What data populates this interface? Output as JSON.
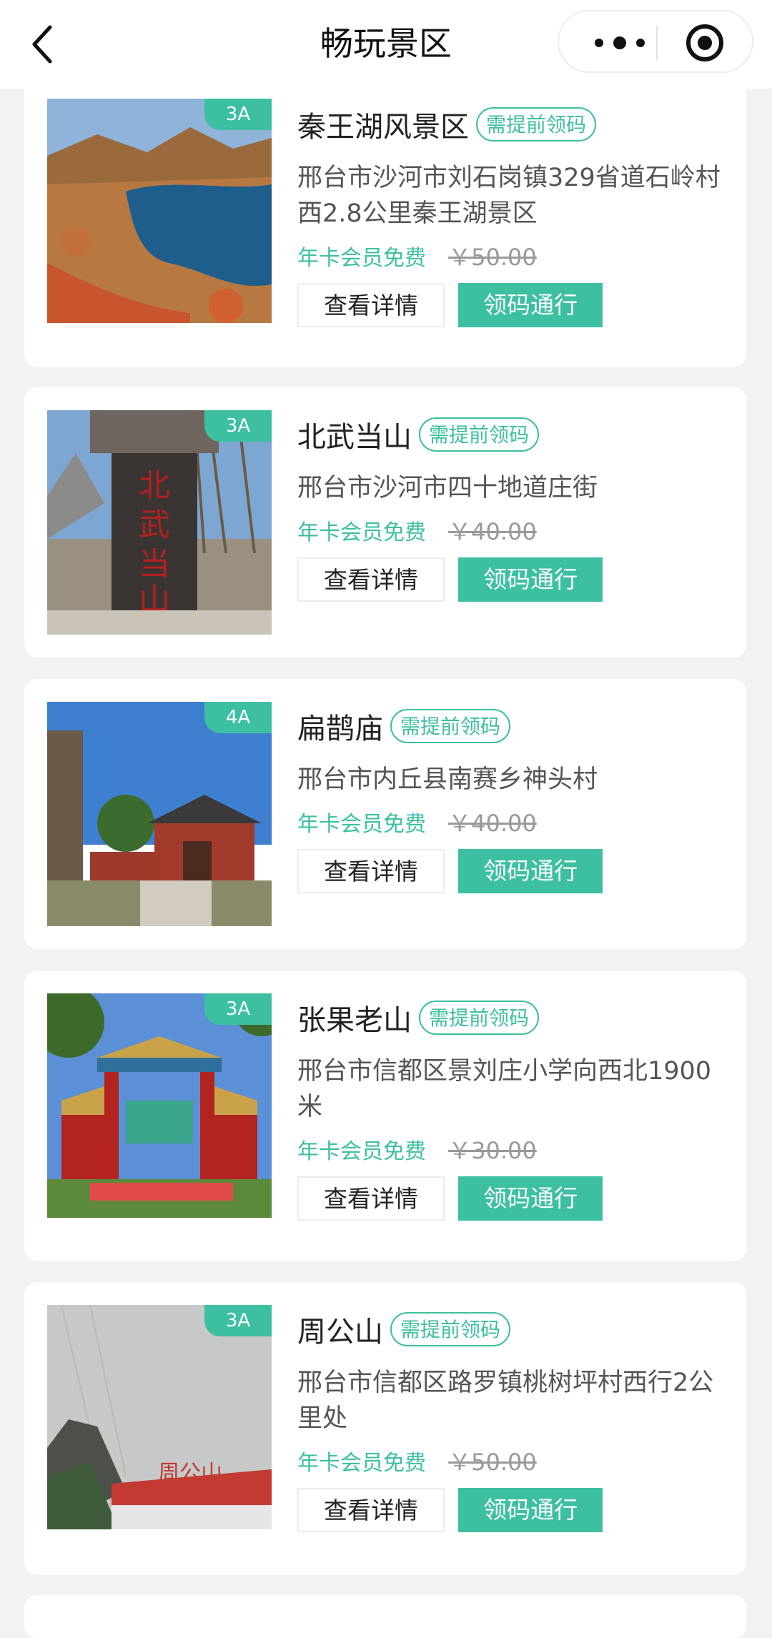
{
  "nav": {
    "title": "畅玩景区",
    "icons": {
      "back": "back-chevron-icon",
      "more": "more-dots-icon",
      "close": "target-circle-icon"
    }
  },
  "colors": {
    "accent": "#3dbfa2",
    "background": "#f2f2f2",
    "card": "#ffffff"
  },
  "list": {
    "items": [
      {
        "name": "秦王湖风景区",
        "tag": "需提前领码",
        "grade": "3A",
        "address": "邢台市沙河市刘石岗镇329省道石岭村西2.8公里秦王湖景区",
        "member": "年卡会员免费",
        "price": "￥50.00",
        "detail": "查看详情",
        "pass": "领码通行"
      },
      {
        "name": "北武当山",
        "tag": "需提前领码",
        "grade": "3A",
        "address": "邢台市沙河市四十地道庄街",
        "member": "年卡会员免费",
        "price": "￥40.00",
        "detail": "查看详情",
        "pass": "领码通行"
      },
      {
        "name": "扁鹊庙",
        "tag": "需提前领码",
        "grade": "4A",
        "address": "邢台市内丘县南赛乡神头村",
        "member": "年卡会员免费",
        "price": "￥40.00",
        "detail": "查看详情",
        "pass": "领码通行"
      },
      {
        "name": "张果老山",
        "tag": "需提前领码",
        "grade": "3A",
        "address": "邢台市信都区景刘庄小学向西北1900米",
        "member": "年卡会员免费",
        "price": "￥30.00",
        "detail": "查看详情",
        "pass": "领码通行"
      },
      {
        "name": "周公山",
        "tag": "需提前领码",
        "grade": "3A",
        "address": "邢台市信都区路罗镇桃树坪村西行2公里处",
        "member": "年卡会员免费",
        "price": "￥50.00",
        "detail": "查看详情",
        "pass": "领码通行"
      }
    ]
  }
}
